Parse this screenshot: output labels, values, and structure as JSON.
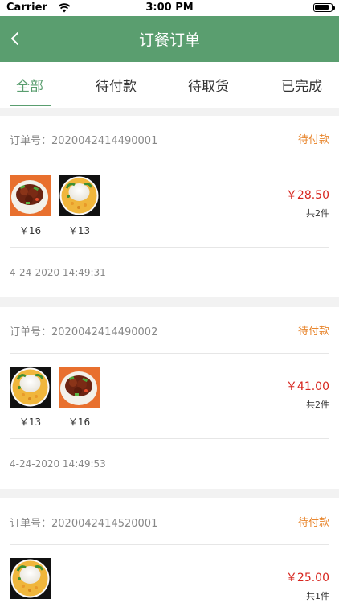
{
  "status_bar": {
    "carrier": "Carrier",
    "time": "3:00 PM"
  },
  "nav": {
    "title": "订餐订单",
    "back_icon": "chevron-left-icon"
  },
  "tabs": [
    {
      "label": "全部",
      "active": true
    },
    {
      "label": "待付款",
      "active": false
    },
    {
      "label": "待取货",
      "active": false
    },
    {
      "label": "已完成",
      "active": false
    }
  ],
  "colors": {
    "brand": "#5a9e6f",
    "status": "#e8862e",
    "price": "#d7261f"
  },
  "orders": [
    {
      "order_label": "订单号：2020042414490001",
      "status": "待付款",
      "items": [
        {
          "dish": "braised-pork-rice",
          "price": "￥16"
        },
        {
          "dish": "egg-rice",
          "price": "￥13"
        }
      ],
      "total": "￥28.50",
      "count": "共2件",
      "date": "4-24-2020 14:49:31"
    },
    {
      "order_label": "订单号：2020042414490002",
      "status": "待付款",
      "items": [
        {
          "dish": "egg-rice",
          "price": "￥13"
        },
        {
          "dish": "braised-pork-rice",
          "price": "￥16"
        }
      ],
      "total": "￥41.00",
      "count": "共2件",
      "date": "4-24-2020 14:49:53"
    },
    {
      "order_label": "订单号：2020042414520001",
      "status": "待付款",
      "items": [
        {
          "dish": "egg-rice",
          "price": ""
        }
      ],
      "total": "￥25.00",
      "count": "共1件",
      "date": ""
    }
  ]
}
